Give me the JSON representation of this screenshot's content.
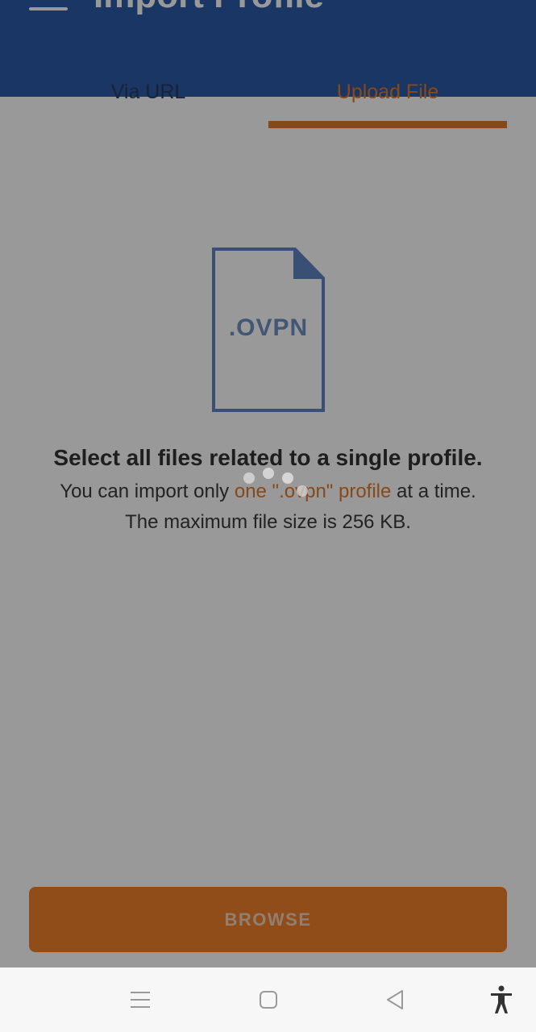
{
  "header": {
    "title": "Import Profile",
    "menu_icon": "hamburger-menu-icon",
    "background": "#1d3f7a"
  },
  "tabs": [
    {
      "label": "Via URL",
      "selected": false
    },
    {
      "label": "Upload File",
      "selected": true
    }
  ],
  "accent_color": "#e07a2e",
  "file_icon": {
    "name": "ovpn-file-icon",
    "label": ".OVPN"
  },
  "message": {
    "headline": "Select all files related to a single profile.",
    "line2_prefix": "You can import only ",
    "line2_highlight": "one \".ovpn\" profile",
    "line2_suffix": " at a time.",
    "line3": "The maximum file size is 256 KB."
  },
  "loading": true,
  "browse_button": {
    "label": "BROWSE"
  },
  "system_nav": {
    "buttons": [
      "recent-apps-icon",
      "home-icon",
      "back-icon",
      "accessibility-icon"
    ]
  }
}
